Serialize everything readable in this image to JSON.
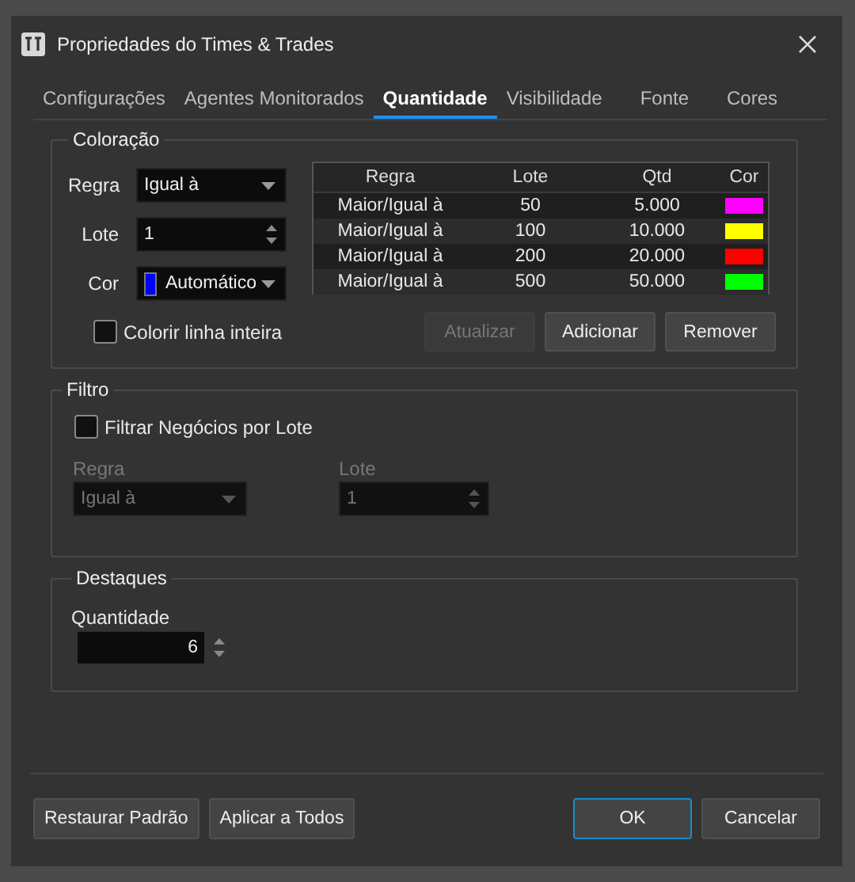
{
  "window": {
    "title": "Propriedades do Times & Trades"
  },
  "tabs": [
    {
      "label": "Configurações",
      "selected": false
    },
    {
      "label": "Agentes Monitorados",
      "selected": false
    },
    {
      "label": "Quantidade",
      "selected": true
    },
    {
      "label": "Visibilidade",
      "selected": false
    },
    {
      "label": "Fonte",
      "selected": false
    },
    {
      "label": "Cores",
      "selected": false
    }
  ],
  "coloracao": {
    "title": "Coloração",
    "fields": [
      {
        "label": "Regra",
        "kind": "dropdown",
        "value": "Igual à"
      },
      {
        "label": "Lote",
        "kind": "spinner",
        "value": "1"
      },
      {
        "label": "Cor",
        "kind": "color",
        "value": "Automático",
        "color": "#0000ff"
      }
    ],
    "checkbox": {
      "label": "Colorir linha inteira",
      "checked": false
    },
    "table": {
      "columns": [
        "Regra",
        "Lote",
        "Qtd",
        "Cor"
      ],
      "rows": [
        {
          "regra": "Maior/Igual à",
          "lote": "50",
          "qtd": "5.000",
          "color": "#ff00ff"
        },
        {
          "regra": "Maior/Igual à",
          "lote": "100",
          "qtd": "10.000",
          "color": "#ffff00"
        },
        {
          "regra": "Maior/Igual à",
          "lote": "200",
          "qtd": "20.000",
          "color": "#ff0000"
        },
        {
          "regra": "Maior/Igual à",
          "lote": "500",
          "qtd": "50.000",
          "color": "#00ff00"
        }
      ]
    },
    "buttons": [
      {
        "label": "Atualizar",
        "disabled": true
      },
      {
        "label": "Adicionar",
        "disabled": false
      },
      {
        "label": "Remover",
        "disabled": false
      }
    ]
  },
  "filtro": {
    "title": "Filtro",
    "checkbox": {
      "label": "Filtrar Negócios por Lote",
      "checked": false
    },
    "fields": [
      {
        "label": "Regra",
        "kind": "dropdown",
        "value": "Igual à",
        "disabled": true
      },
      {
        "label": "Lote",
        "kind": "spinner",
        "value": "1",
        "disabled": true
      }
    ]
  },
  "destaques": {
    "title": "Destaques",
    "fields": [
      {
        "label": "Quantidade",
        "kind": "spinner",
        "value": "6"
      }
    ]
  },
  "footer_buttons": [
    {
      "label": "Restaurar Padrão",
      "default": false
    },
    {
      "label": "Aplicar a Todos",
      "default": false
    },
    {
      "label": "OK",
      "default": true
    },
    {
      "label": "Cancelar",
      "default": false
    }
  ]
}
